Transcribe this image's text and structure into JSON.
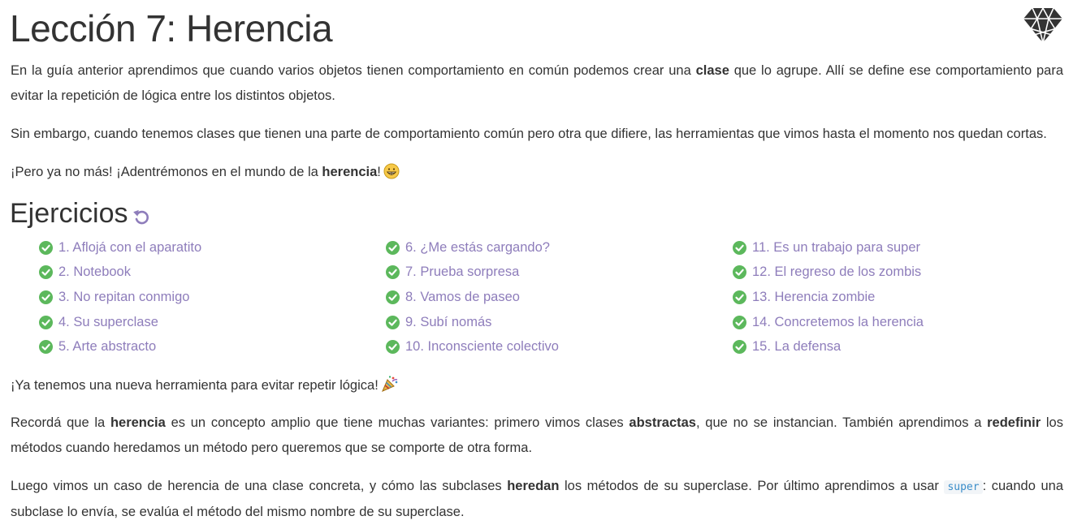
{
  "title": "Lección 7: Herencia",
  "logo_icon": "ruby-gem-icon",
  "intro": {
    "p1": {
      "a": "En la guía anterior aprendimos que cuando varios objetos tienen comportamiento en común podemos crear una ",
      "b": "clase",
      "c": " que lo agrupe. Allí se define ese comportamiento para evitar la repetición de lógica entre los distintos objetos."
    },
    "p2": "Sin embargo, cuando tenemos clases que tienen una parte de comportamiento común pero otra que difiere, las herramientas que vimos hasta el momento nos quedan cortas.",
    "p3": {
      "a": "¡Pero ya no más! ¡Adentrémonos en el mundo de la ",
      "b": "herencia",
      "c": "!",
      "emoji": "grinning-face-emoji"
    }
  },
  "exercises": {
    "heading": "Ejercicios",
    "restart_icon": "restart-icon",
    "status_icon": "check-circle-icon",
    "columns": [
      [
        "1. Aflojá con el aparatito",
        "2. Notebook",
        "3. No repitan conmigo",
        "4. Su superclase",
        "5. Arte abstracto"
      ],
      [
        "6. ¿Me estás cargando?",
        "7. Prueba sorpresa",
        "8. Vamos de paseo",
        "9. Subí nomás",
        "10. Inconsciente colectivo"
      ],
      [
        "11. Es un trabajo para super",
        "12. El regreso de los zombis",
        "13. Herencia zombie",
        "14. Concretemos la herencia",
        "15. La defensa"
      ]
    ]
  },
  "outro": {
    "p1": {
      "a": "¡Ya tenemos una nueva herramienta para evitar repetir lógica!",
      "emoji": "party-popper-emoji"
    },
    "p2": {
      "a": "Recordá que la ",
      "b": "herencia",
      "c": " es un concepto amplio que tiene muchas variantes: primero vimos clases ",
      "d": "abstractas",
      "e": ", que no se instancian. También aprendimos a ",
      "f": "redefinir",
      "g": " los métodos cuando heredamos un método pero queremos que se comporte de otra forma."
    },
    "p3": {
      "a": "Luego vimos un caso de herencia de una clase concreta, y cómo las subclases ",
      "b": "heredan",
      "c": " los métodos de su superclase. Por último aprendimos a usar ",
      "code": "super",
      "d": ": cuando una subclase lo envía, se evalúa el método del mismo nombre de su superclase."
    }
  },
  "colors": {
    "link": "#8e7dbb",
    "check": "#5cb85c",
    "text": "#333333",
    "code": "#3a8dc9"
  }
}
